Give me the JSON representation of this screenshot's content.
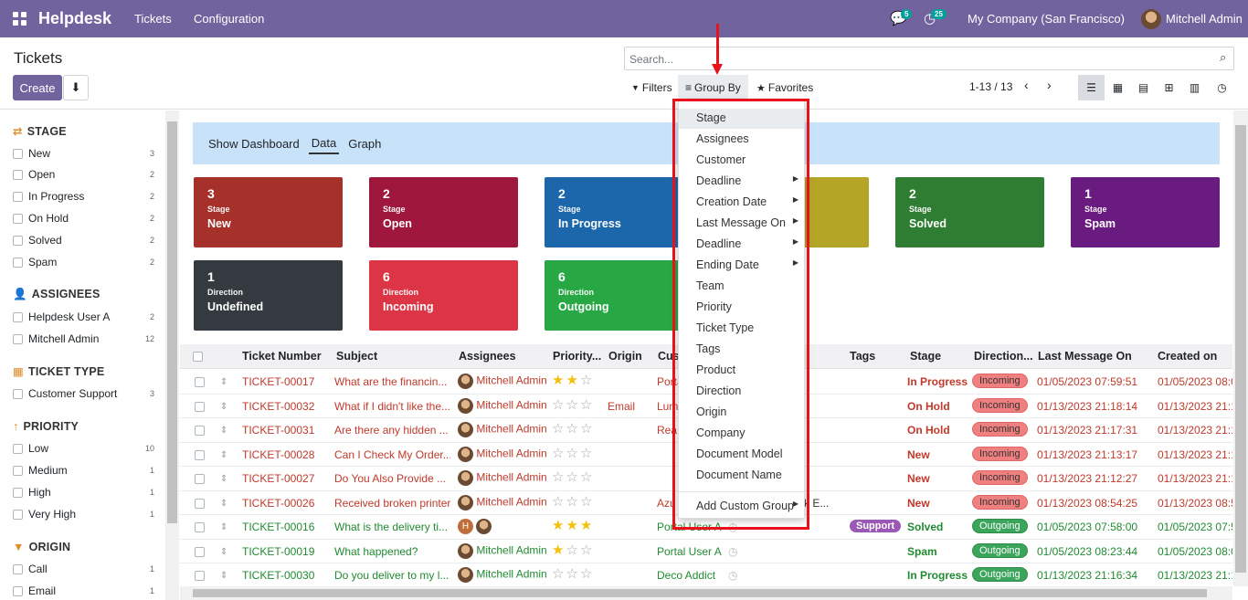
{
  "topbar": {
    "app_name": "Helpdesk",
    "menu": [
      "Tickets",
      "Configuration"
    ],
    "chat_badge": "5",
    "activity_badge": "25",
    "company": "My Company (San Francisco)",
    "user": "Mitchell Admin"
  },
  "control": {
    "title": "Tickets",
    "create_label": "Create",
    "search_placeholder": "Search...",
    "filters_label": "Filters",
    "groupby_label": "Group By",
    "favorites_label": "Favorites",
    "pager": "1-13 / 13"
  },
  "sidebar": {
    "stage": {
      "title": "STAGE",
      "items": [
        {
          "label": "New",
          "count": "3"
        },
        {
          "label": "Open",
          "count": "2"
        },
        {
          "label": "In Progress",
          "count": "2"
        },
        {
          "label": "On Hold",
          "count": "2"
        },
        {
          "label": "Solved",
          "count": "2"
        },
        {
          "label": "Spam",
          "count": "2"
        }
      ]
    },
    "assignees": {
      "title": "ASSIGNEES",
      "items": [
        {
          "label": "Helpdesk User A",
          "count": "2"
        },
        {
          "label": "Mitchell Admin",
          "count": "12"
        }
      ]
    },
    "ticket_type": {
      "title": "TICKET TYPE",
      "items": [
        {
          "label": "Customer Support",
          "count": "3"
        }
      ]
    },
    "priority": {
      "title": "PRIORITY",
      "items": [
        {
          "label": "Low",
          "count": "10"
        },
        {
          "label": "Medium",
          "count": "1"
        },
        {
          "label": "High",
          "count": "1"
        },
        {
          "label": "Very High",
          "count": "1"
        }
      ]
    },
    "origin": {
      "title": "ORIGIN",
      "items": [
        {
          "label": "Call",
          "count": "1"
        },
        {
          "label": "Email",
          "count": "1"
        }
      ]
    }
  },
  "dashbar": {
    "show_dashboard": "Show Dashboard",
    "data": "Data",
    "graph": "Graph"
  },
  "cards": [
    {
      "num": "3",
      "label": "Stage",
      "value": "New",
      "color": "#a6312a"
    },
    {
      "num": "2",
      "label": "Stage",
      "value": "Open",
      "color": "#a0173e"
    },
    {
      "num": "2",
      "label": "Stage",
      "value": "In Progress",
      "color": "#1c67ac"
    },
    {
      "num": "",
      "label": "",
      "value": "",
      "color": "#b5a526"
    },
    {
      "num": "2",
      "label": "Stage",
      "value": "Solved",
      "color": "#2f7d32"
    },
    {
      "num": "1",
      "label": "Stage",
      "value": "Spam",
      "color": "#6a1b7f"
    },
    {
      "num": "1",
      "label": "Direction",
      "value": "Undefined",
      "color": "#343a40"
    },
    {
      "num": "6",
      "label": "Direction",
      "value": "Incoming",
      "color": "#dc3545"
    },
    {
      "num": "6",
      "label": "Direction",
      "value": "Outgoing",
      "color": "#28a745"
    }
  ],
  "table": {
    "headers": [
      "Ticket Number",
      "Subject",
      "Assignees",
      "Priority...",
      "Origin",
      "Cus",
      "Tags",
      "Stage",
      "Direction...",
      "Last Message On",
      "Created on"
    ],
    "rows": [
      {
        "num": "TICKET-00017",
        "subject": "What are the financin...",
        "assignee": "Mitchell Admin",
        "stars": 2,
        "origin": "",
        "customer": "Portal",
        "tags": "",
        "stage": "In Progress",
        "direction": "Incoming",
        "last": "01/05/2023 07:59:51",
        "created": "01/05/2023 08:0",
        "color": "red"
      },
      {
        "num": "TICKET-00032",
        "subject": "What if I didn't like the...",
        "assignee": "Mitchell Admin",
        "stars": 0,
        "origin": "Email",
        "customer": "Lum",
        "tags": "",
        "stage": "On Hold",
        "direction": "Incoming",
        "last": "01/13/2023 21:18:14",
        "created": "01/13/2023 21:1",
        "color": "red"
      },
      {
        "num": "TICKET-00031",
        "subject": "Are there any hidden ...",
        "assignee": "Mitchell Admin",
        "stars": 0,
        "origin": "",
        "customer": "Rea",
        "tags": "",
        "stage": "On Hold",
        "direction": "Incoming",
        "last": "01/13/2023 21:17:31",
        "created": "01/13/2023 21:1",
        "color": "red"
      },
      {
        "num": "TICKET-00028",
        "subject": "Can I Check My Order...",
        "assignee": "Mitchell Admin",
        "stars": 0,
        "origin": "",
        "customer": "",
        "tags": "",
        "stage": "New",
        "direction": "Incoming",
        "last": "01/13/2023 21:13:17",
        "created": "01/13/2023 21:1",
        "color": "red"
      },
      {
        "num": "TICKET-00027",
        "subject": "Do You Also Provide ...",
        "assignee": "Mitchell Admin",
        "stars": 0,
        "origin": "",
        "customer": "",
        "tags": "",
        "stage": "New",
        "direction": "Incoming",
        "last": "01/13/2023 21:12:27",
        "created": "01/13/2023 21:1",
        "color": "red"
      },
      {
        "num": "TICKET-00026",
        "subject": "Received broken printer",
        "assignee": "Mitchell Admin",
        "stars": 0,
        "origin": "",
        "customer": "Azu",
        "tags": "ck E...",
        "stage": "New",
        "direction": "Incoming",
        "last": "01/13/2023 08:54:25",
        "created": "01/13/2023 08:5",
        "color": "red"
      },
      {
        "num": "TICKET-00016",
        "subject": "What is the delivery ti...",
        "assignee": "",
        "stars": 3,
        "origin": "",
        "customer": "Portal User A",
        "tags": "Support",
        "stage": "Solved",
        "direction": "Outgoing",
        "last": "01/05/2023 07:58:00",
        "created": "01/05/2023 07:5",
        "color": "green"
      },
      {
        "num": "TICKET-00019",
        "subject": "What happened?",
        "assignee": "Mitchell Admin",
        "stars": 1,
        "origin": "",
        "customer": "Portal User A",
        "tags": "",
        "stage": "Spam",
        "direction": "Outgoing",
        "last": "01/05/2023 08:23:44",
        "created": "01/05/2023 08:0",
        "color": "green"
      },
      {
        "num": "TICKET-00030",
        "subject": "Do you deliver to my l...",
        "assignee": "Mitchell Admin",
        "stars": 0,
        "origin": "",
        "customer": "Deco Addict",
        "tags": "",
        "stage": "In Progress",
        "direction": "Outgoing",
        "last": "01/13/2023 21:16:34",
        "created": "01/13/2023 21:1",
        "color": "green"
      }
    ]
  },
  "groupby_menu": {
    "items": [
      {
        "label": "Stage",
        "sub": false
      },
      {
        "label": "Assignees",
        "sub": false
      },
      {
        "label": "Customer",
        "sub": false
      },
      {
        "label": "Deadline",
        "sub": true
      },
      {
        "label": "Creation Date",
        "sub": true
      },
      {
        "label": "Last Message On",
        "sub": true
      },
      {
        "label": "Deadline",
        "sub": true
      },
      {
        "label": "Ending Date",
        "sub": true
      },
      {
        "label": "Team",
        "sub": false
      },
      {
        "label": "Priority",
        "sub": false
      },
      {
        "label": "Ticket Type",
        "sub": false
      },
      {
        "label": "Tags",
        "sub": false
      },
      {
        "label": "Product",
        "sub": false
      },
      {
        "label": "Direction",
        "sub": false
      },
      {
        "label": "Origin",
        "sub": false
      },
      {
        "label": "Company",
        "sub": false
      },
      {
        "label": "Document Model",
        "sub": false
      },
      {
        "label": "Document Name",
        "sub": false
      }
    ],
    "custom": "Add Custom Group"
  }
}
